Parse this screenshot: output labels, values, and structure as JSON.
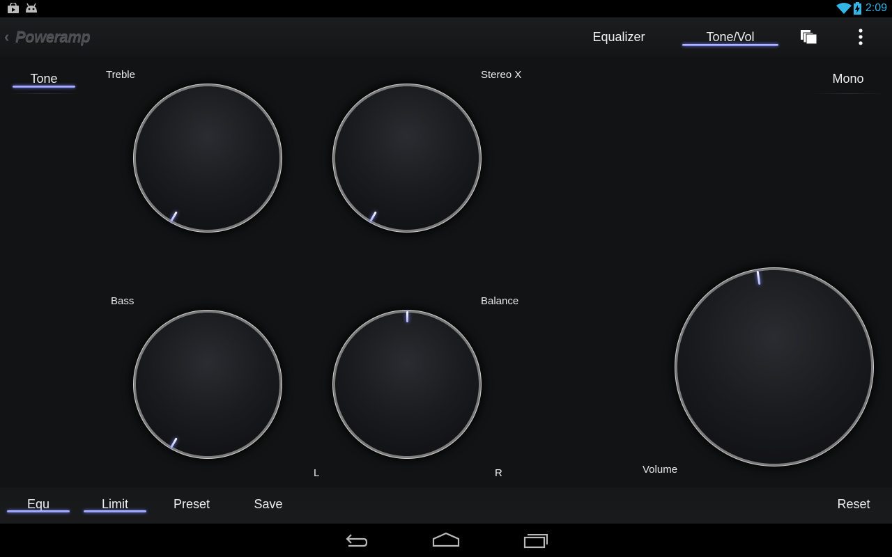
{
  "statusbar": {
    "time": "2:09",
    "icons": [
      "store-bag-icon",
      "android-icon",
      "wifi-icon",
      "battery-charging-icon"
    ]
  },
  "actionbar": {
    "logo": "Poweramp",
    "tabs": [
      {
        "label": "Equalizer",
        "active": false
      },
      {
        "label": "Tone/Vol",
        "active": true
      }
    ],
    "icons": [
      "presets-icon",
      "overflow-menu-icon"
    ]
  },
  "panel": {
    "tone_toggle": {
      "label": "Tone",
      "on": true
    },
    "mono_toggle": {
      "label": "Mono",
      "on": false
    },
    "knobs": {
      "treble": {
        "label": "Treble"
      },
      "stereo_x": {
        "label": "Stereo X"
      },
      "bass": {
        "label": "Bass"
      },
      "balance": {
        "label": "Balance",
        "left_label": "L",
        "right_label": "R"
      },
      "volume": {
        "label": "Volume"
      }
    }
  },
  "bottombar": {
    "equ": {
      "label": "Equ",
      "on": true
    },
    "limit": {
      "label": "Limit",
      "on": true
    },
    "preset": {
      "label": "Preset"
    },
    "save": {
      "label": "Save"
    },
    "reset": {
      "label": "Reset"
    }
  },
  "navbar": {
    "icons": [
      "back-icon",
      "home-icon",
      "recent-apps-icon"
    ]
  },
  "colors": {
    "accent": "#8f98ff",
    "status_time": "#33b5e5",
    "background": "#121314"
  }
}
